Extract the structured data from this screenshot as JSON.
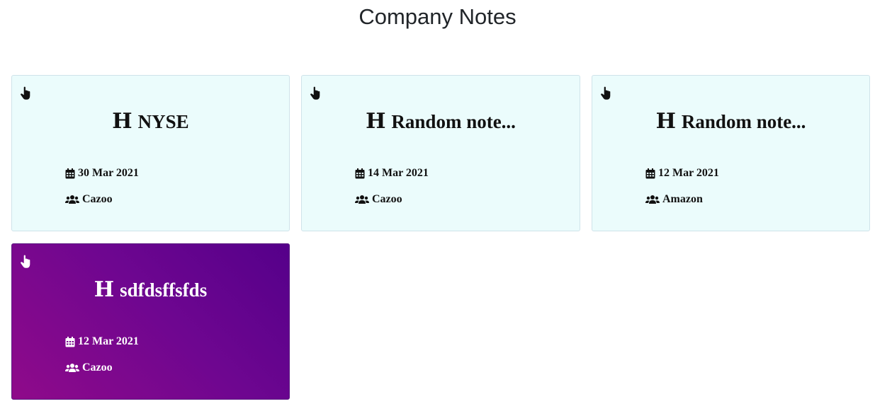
{
  "page": {
    "title": "Company Notes"
  },
  "colors": {
    "card_background": "#ebfcfc",
    "card_border": "#cfe3ea",
    "selected_gradient_start": "#8f0a8a",
    "selected_gradient_end": "#55008a",
    "text_dark": "#111111",
    "text_light": "#ffffff"
  },
  "icons": {
    "pointer": "hand-pointer-icon",
    "heading": "heading-icon",
    "date": "calendar-icon",
    "company": "users-icon"
  },
  "notes": [
    {
      "heading_glyph": "H",
      "title": "NYSE",
      "date": "30 Mar 2021",
      "company": "Cazoo",
      "selected": false
    },
    {
      "heading_glyph": "H",
      "title": "Random note...",
      "date": "14 Mar 2021",
      "company": "Cazoo",
      "selected": false
    },
    {
      "heading_glyph": "H",
      "title": "Random note...",
      "date": "12 Mar 2021",
      "company": "Amazon",
      "selected": false
    },
    {
      "heading_glyph": "H",
      "title": "sdfdsffsfds",
      "date": "12 Mar 2021",
      "company": "Cazoo",
      "selected": true
    }
  ]
}
